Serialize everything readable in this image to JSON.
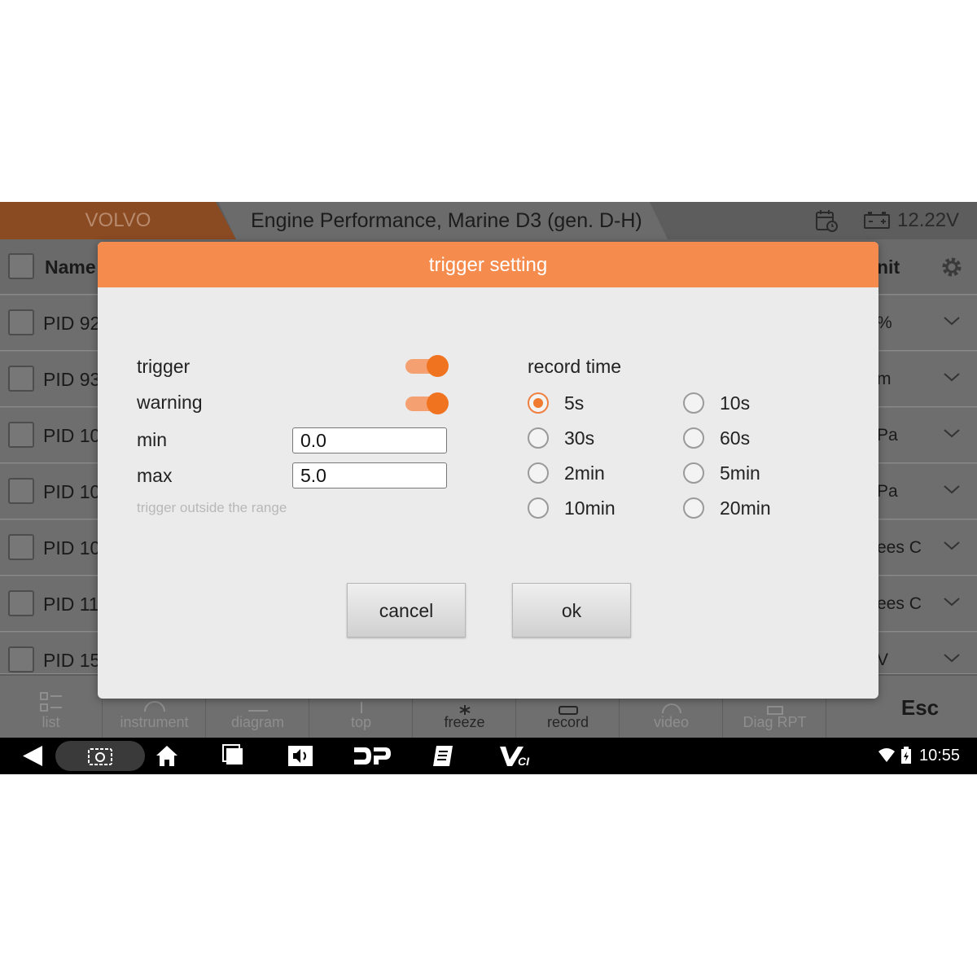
{
  "header": {
    "brand": "VOLVO",
    "title": "Engine Performance, Marine D3 (gen. D-H)",
    "voltage": "12.22V"
  },
  "list": {
    "header_name": "Name",
    "header_unit": "nit",
    "rows": [
      {
        "name": "PID 92",
        "unit": "%"
      },
      {
        "name": "PID 93",
        "unit": "m"
      },
      {
        "name": "PID 10",
        "unit": "Pa"
      },
      {
        "name": "PID 10",
        "unit": "Pa"
      },
      {
        "name": "PID 10",
        "unit": "ees C"
      },
      {
        "name": "PID 11",
        "unit": "ees C"
      },
      {
        "name": "PID 15",
        "unit": "V"
      }
    ]
  },
  "toolbar": {
    "items": [
      {
        "label": "list",
        "active": false
      },
      {
        "label": "instrument",
        "active": false
      },
      {
        "label": "diagram",
        "active": false
      },
      {
        "label": "top",
        "active": false
      },
      {
        "label": "freeze",
        "active": true
      },
      {
        "label": "record",
        "active": true
      },
      {
        "label": "video",
        "active": false
      },
      {
        "label": "Diag RPT",
        "active": false
      }
    ],
    "esc": "Esc"
  },
  "statusbar": {
    "time": "10:55"
  },
  "dialog": {
    "title": "trigger setting",
    "trigger_label": "trigger",
    "trigger_on": true,
    "warning_label": "warning",
    "warning_on": true,
    "min_label": "min",
    "min_value": "0.0",
    "max_label": "max",
    "max_value": "5.0",
    "hint": "trigger outside the range",
    "record_time_label": "record time",
    "record_options": [
      "5s",
      "10s",
      "30s",
      "60s",
      "2min",
      "5min",
      "10min",
      "20min"
    ],
    "record_selected": "5s",
    "cancel_label": "cancel",
    "ok_label": "ok"
  },
  "colors": {
    "accent": "#f58c4e",
    "brand_tab": "#8a4a22"
  }
}
